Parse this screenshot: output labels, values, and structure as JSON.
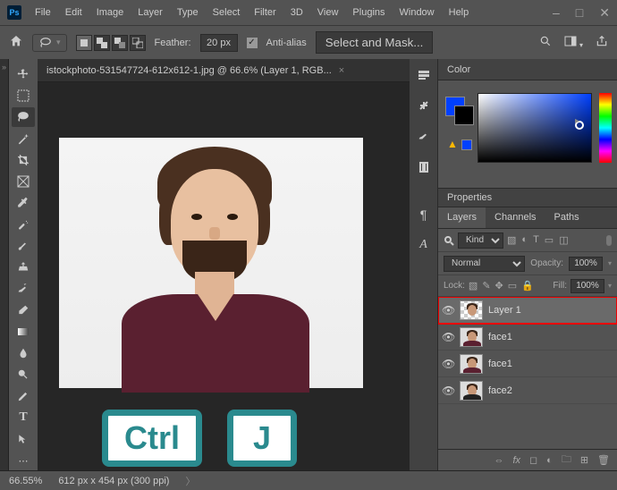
{
  "app": {
    "logo": "Ps"
  },
  "menu": [
    "File",
    "Edit",
    "Image",
    "Layer",
    "Type",
    "Select",
    "Filter",
    "3D",
    "View",
    "Plugins",
    "Window",
    "Help"
  ],
  "window_controls": {
    "min": "–",
    "max": "□",
    "close": "✕"
  },
  "options": {
    "feather_label": "Feather:",
    "feather_value": "20 px",
    "antialias_label": "Anti-alias",
    "antialias_checked": "✓",
    "select_mask": "Select and Mask..."
  },
  "doc": {
    "tab": "istockphoto-531547724-612x612-1.jpg @ 66.6% (Layer 1, RGB...",
    "close": "×"
  },
  "keys": {
    "ctrl": "Ctrl",
    "j": "J"
  },
  "panels": {
    "color_title": "Color",
    "properties_title": "Properties",
    "layer_tabs": {
      "layers": "Layers",
      "channels": "Channels",
      "paths": "Paths"
    },
    "kind_label": "Kind",
    "blend_mode": "Normal",
    "opacity_label": "Opacity:",
    "opacity_value": "100%",
    "lock_label": "Lock:",
    "fill_label": "Fill:",
    "fill_value": "100%"
  },
  "layers": [
    {
      "name": "Layer 1",
      "selected": true,
      "transparent": true
    },
    {
      "name": "face1",
      "selected": false,
      "transparent": false
    },
    {
      "name": "face1",
      "selected": false,
      "transparent": false
    },
    {
      "name": "face2",
      "selected": false,
      "transparent": false
    }
  ],
  "status": {
    "zoom": "66.55%",
    "dims": "612 px x 454 px (300 ppi)"
  },
  "colors": {
    "accent": "#0040ff"
  }
}
